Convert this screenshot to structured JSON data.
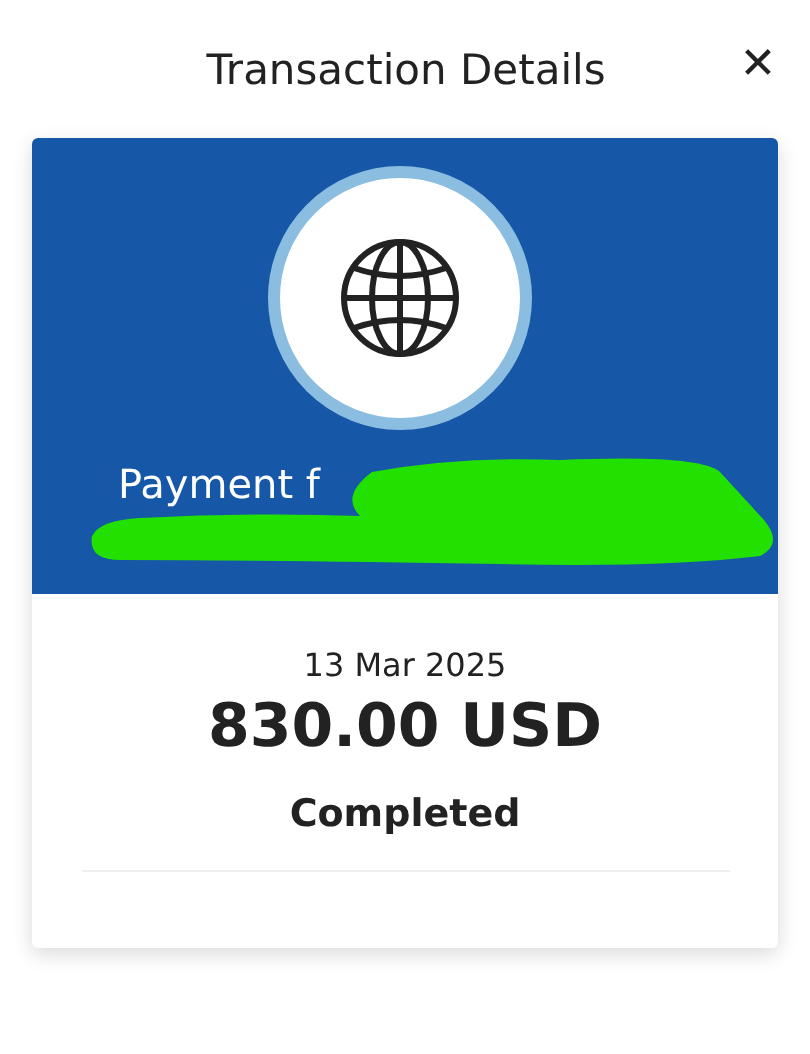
{
  "header": {
    "title": "Transaction Details",
    "close": "✕"
  },
  "transaction": {
    "description": "Payment f",
    "date": "13 Mar 2025",
    "amount": "830.00 USD",
    "status": "Completed"
  }
}
